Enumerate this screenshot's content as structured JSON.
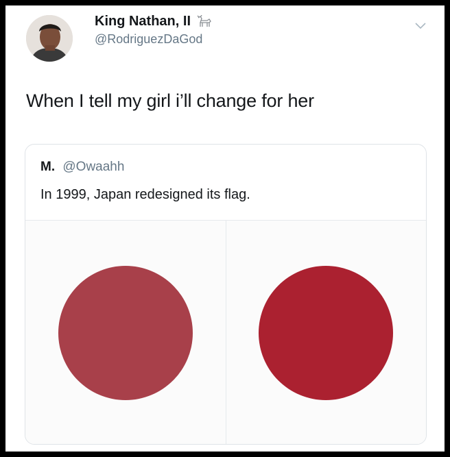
{
  "tweet": {
    "author": {
      "display_name": "King Nathan, II",
      "handle": "@RodriguezDaGod",
      "badge_icon": "goat-icon",
      "avatar": "profile-photo"
    },
    "text": "When I tell my girl i’ll change for her",
    "menu_icon": "chevron-down-icon"
  },
  "quote": {
    "name": "M.",
    "handle": "@Owaahh",
    "text": "In 1999, Japan redesigned its flag.",
    "images": [
      {
        "name": "old-flag",
        "circle_color": "#a8404a"
      },
      {
        "name": "new-flag",
        "circle_color": "#ab2130"
      }
    ]
  }
}
